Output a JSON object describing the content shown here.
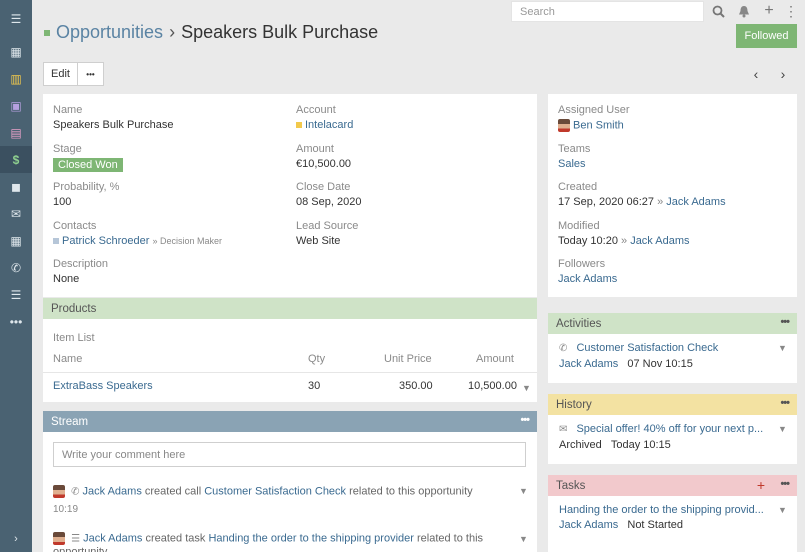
{
  "sidebar": {
    "items": [
      {
        "icon": "dashboard-icon",
        "glyph": "▦"
      },
      {
        "icon": "accounts-icon",
        "glyph": "▥",
        "color": "#f2c94c"
      },
      {
        "icon": "contacts-icon",
        "glyph": "▣",
        "color": "#b6a0e0"
      },
      {
        "icon": "leads-icon",
        "glyph": "▤",
        "color": "#e6a0c8"
      },
      {
        "icon": "opportunities-icon",
        "glyph": "$",
        "color": "#8fd08f"
      },
      {
        "icon": "cases-icon",
        "glyph": "◼"
      },
      {
        "icon": "email-icon",
        "glyph": "✉"
      },
      {
        "icon": "calendar-icon",
        "glyph": "▦"
      },
      {
        "icon": "calls-icon",
        "glyph": "✆"
      },
      {
        "icon": "tasks-icon",
        "glyph": "☰"
      },
      {
        "icon": "more-icon",
        "glyph": "•••"
      }
    ]
  },
  "topbar": {
    "search_placeholder": "Search"
  },
  "header": {
    "breadcrumb_root": "Opportunities",
    "separator": "›",
    "title": "Speakers Bulk Purchase",
    "followed_label": "Followed"
  },
  "actions": {
    "edit_label": "Edit",
    "more_label": "•••"
  },
  "detail": {
    "name_label": "Name",
    "name_value": "Speakers Bulk Purchase",
    "account_label": "Account",
    "account_value": "Intelacard",
    "stage_label": "Stage",
    "stage_value": "Closed Won",
    "amount_label": "Amount",
    "amount_value": "€10,500.00",
    "probability_label": "Probability, %",
    "probability_value": "100",
    "close_date_label": "Close Date",
    "close_date_value": "08 Sep, 2020",
    "contacts_label": "Contacts",
    "contact_name": "Patrick Schroeder",
    "contact_role": "» Decision Maker",
    "lead_source_label": "Lead Source",
    "lead_source_value": "Web Site",
    "description_label": "Description",
    "description_value": "None"
  },
  "products": {
    "title": "Products",
    "item_list_label": "Item List",
    "columns": {
      "name": "Name",
      "qty": "Qty",
      "unit_price": "Unit Price",
      "amount": "Amount"
    },
    "rows": [
      {
        "name": "ExtraBass Speakers",
        "qty": "30",
        "unit_price": "350.00",
        "amount": "10,500.00"
      }
    ]
  },
  "stream": {
    "title": "Stream",
    "comment_placeholder": "Write your comment here",
    "entries": [
      {
        "user": "Jack Adams",
        "verb": "created call",
        "target": "Customer Satisfaction Check",
        "suffix": "related to this opportunity",
        "time": "10:19"
      },
      {
        "user": "Jack Adams",
        "verb": "created task",
        "target": "Handing the order to the shipping provider",
        "suffix": "related to this",
        "suffix2": "opportunity"
      }
    ]
  },
  "side": {
    "assigned_user_label": "Assigned User",
    "assigned_user": "Ben Smith",
    "teams_label": "Teams",
    "teams_value": "Sales",
    "created_label": "Created",
    "created_date": "17 Sep, 2020 06:27",
    "created_by": "Jack Adams",
    "modified_label": "Modified",
    "modified_date": "Today 10:20",
    "modified_by": "Jack Adams",
    "followers_label": "Followers",
    "followers_value": "Jack Adams",
    "by_sep": "»"
  },
  "activities": {
    "title": "Activities",
    "item_title": "Customer Satisfaction Check",
    "item_user": "Jack Adams",
    "item_date": "07 Nov 10:15"
  },
  "history": {
    "title": "History",
    "item_title": "Special offer! 40% off for your next p...",
    "item_status": "Archived",
    "item_date": "Today 10:15"
  },
  "tasks": {
    "title": "Tasks",
    "add_label": "+",
    "item_title": "Handing the order to the shipping provid...",
    "item_user": "Jack Adams",
    "item_status": "Not Started"
  },
  "colors": {
    "accent_green": "#7eb674",
    "stream_header": "#8aa3b4",
    "sidebar": "#4a6272"
  }
}
